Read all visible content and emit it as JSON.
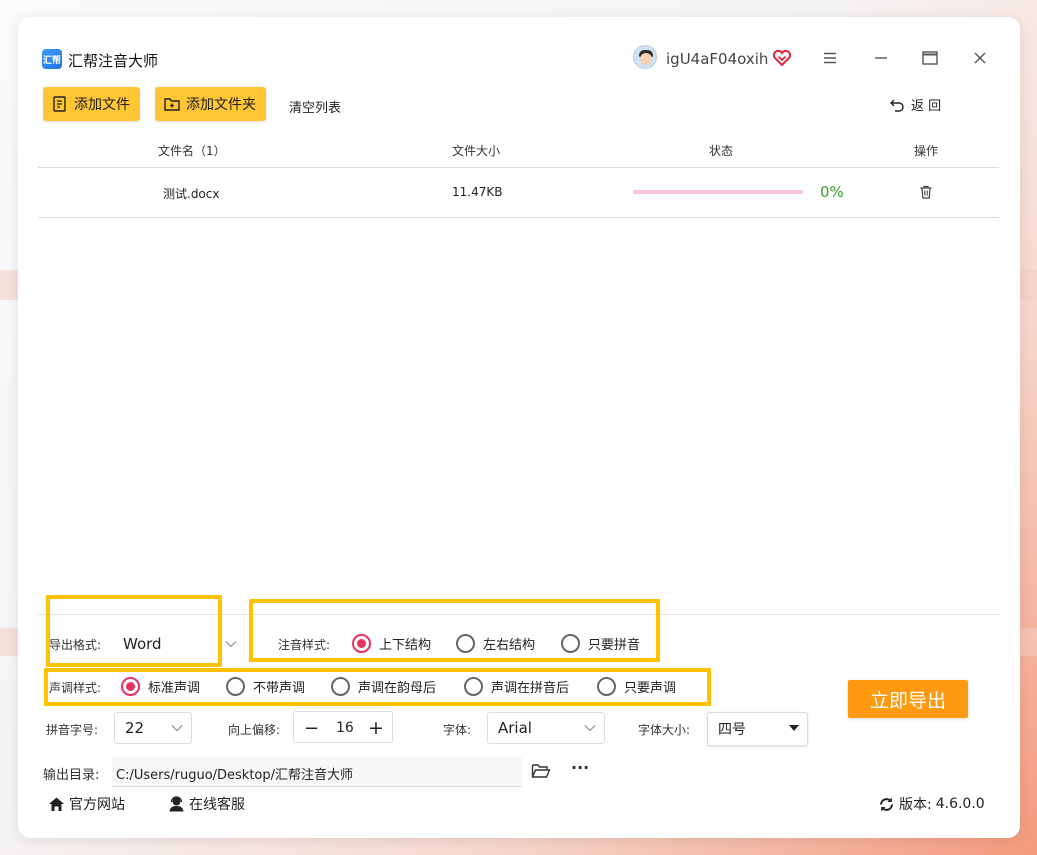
{
  "app": {
    "title": "汇帮注音大师",
    "logo_text": "汇帮",
    "username": "igU4aF04oxih"
  },
  "toolbar": {
    "add_file_label": "添加文件",
    "add_folder_label": "添加文件夹",
    "clear_list_label": "清空列表",
    "back_label": "返 回"
  },
  "table": {
    "headers": [
      "文件名（1）",
      "文件大小",
      "状态",
      "操作"
    ],
    "rows": [
      {
        "name": "测试.docx",
        "size": "11.47KB",
        "progress": 0,
        "progress_label": "0%"
      }
    ]
  },
  "settings": {
    "export_format_label": "导出格式:",
    "export_format_value": "Word",
    "annotation_style_label": "注音样式:",
    "annotation_styles": [
      "上下结构",
      "左右结构",
      "只要拼音"
    ],
    "annotation_selected": "上下结构",
    "tone_style_label": "声调样式:",
    "tone_styles": [
      "标准声调",
      "不带声调",
      "声调在韵母后",
      "声调在拼音后",
      "只要声调"
    ],
    "tone_selected": "标准声调",
    "pinyin_size_label": "拼音字号:",
    "pinyin_size_value": "22",
    "offset_label": "向上偏移:",
    "offset_value": "16",
    "font_label": "字体:",
    "font_value": "Arial",
    "font_size_label": "字体大小:",
    "font_size_value": "四号",
    "output_dir_label": "输出目录:",
    "output_dir_value": "C:/Users/ruguo/Desktop/汇帮注音大师",
    "export_button_label": "立即导出"
  },
  "footer": {
    "website_label": "官方网站",
    "support_label": "在线客服",
    "version_label": "版本:",
    "version_value": "4.6.0.0"
  },
  "colors": {
    "accent_yellow": "#ffc533",
    "export_orange": "#ff9a10",
    "radio_pink": "#e8315e",
    "progress_green": "#33a02c",
    "highlight_yellow": "#ffc100"
  }
}
